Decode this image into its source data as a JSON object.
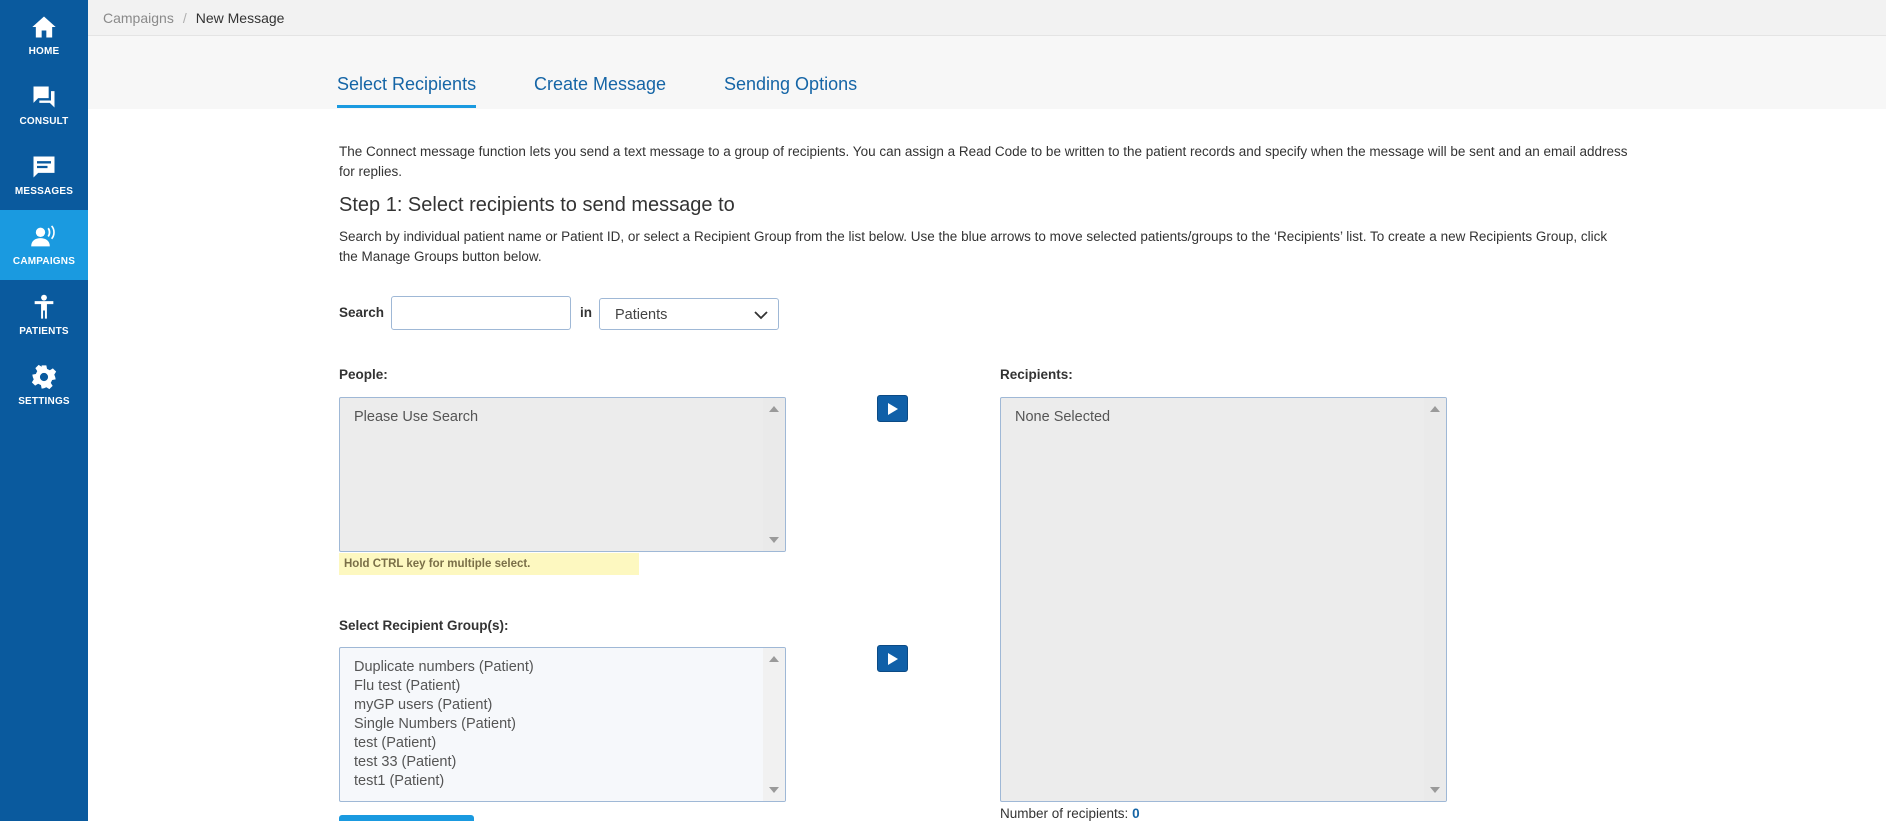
{
  "sidebar": {
    "items": [
      {
        "label": "HOME",
        "icon": "home-icon"
      },
      {
        "label": "CONSULT",
        "icon": "chat-icon"
      },
      {
        "label": "MESSAGES",
        "icon": "message-icon"
      },
      {
        "label": "CAMPAIGNS",
        "icon": "campaign-icon",
        "active": true
      },
      {
        "label": "PATIENTS",
        "icon": "person-icon"
      },
      {
        "label": "SETTINGS",
        "icon": "gear-icon"
      }
    ]
  },
  "breadcrumb": {
    "parent": "Campaigns",
    "separator": "/",
    "current": "New Message"
  },
  "tabs": [
    {
      "label": "Select Recipients",
      "active": true
    },
    {
      "label": "Create Message"
    },
    {
      "label": "Sending Options"
    }
  ],
  "main": {
    "intro": "The Connect message function lets you send a text message to a group of recipients. You can assign a Read Code to be written to the patient records and specify when the message will be sent and an email address for replies.",
    "step_title": "Step 1: Select recipients to send message to",
    "instructions": "Search by individual patient name or Patient ID, or select a Recipient Group from the list below. Use the blue arrows to move selected patients/groups to the ‘Recipients’ list. To create a new Recipients Group, click the Manage Groups button below.",
    "search": {
      "label": "Search",
      "value": "",
      "placeholder": "",
      "in_label": "in",
      "scope_selected": "Patients"
    },
    "people": {
      "label": "People:",
      "placeholder_item": "Please Use Search",
      "hint": "Hold CTRL key for multiple select."
    },
    "groups": {
      "label": "Select Recipient Group(s):",
      "items": [
        "Duplicate numbers (Patient)",
        "Flu test (Patient)",
        "myGP users (Patient)",
        "Single Numbers (Patient)",
        "test (Patient)",
        "test 33 (Patient)",
        "test1 (Patient)"
      ]
    },
    "recipients": {
      "label": "Recipients:",
      "placeholder_item": "None Selected",
      "count_label": "Number of recipients:",
      "count_value": "0"
    }
  },
  "colors": {
    "sidebar": "#0a5a9e",
    "sidebar_active": "#1a9ae0",
    "link": "#1565a6",
    "arrow_button": "#1060a8",
    "hint_bg": "#fdf8c0"
  }
}
